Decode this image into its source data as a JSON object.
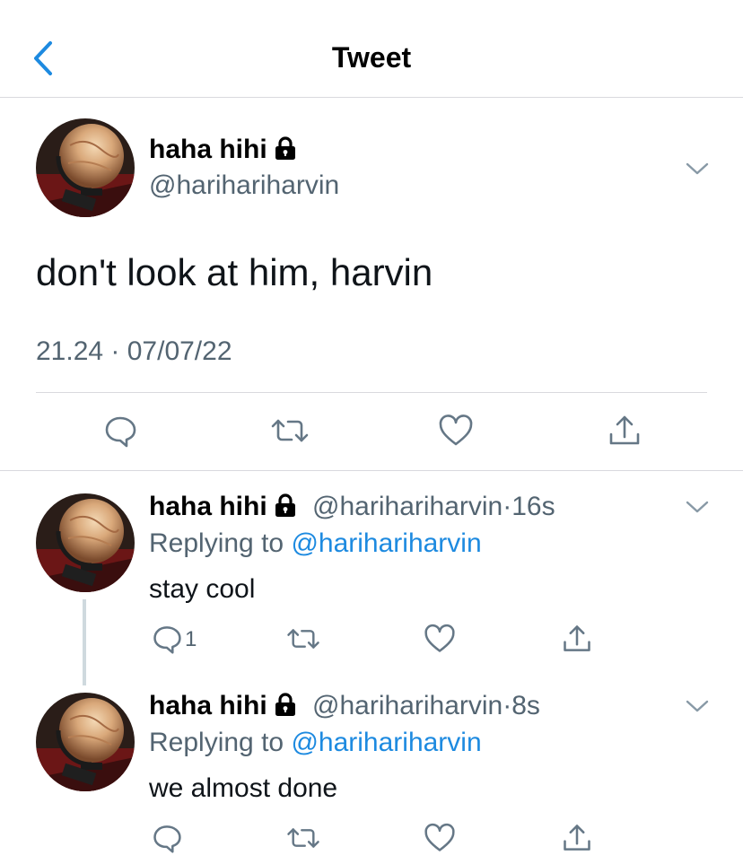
{
  "header": {
    "title": "Tweet"
  },
  "main_tweet": {
    "name": "haha hihi",
    "handle": "@harihariharvin",
    "text": "don't look at him, harvin",
    "timestamp": "21.24 · 07/07/22"
  },
  "replies": [
    {
      "name": "haha hihi",
      "handle": "@harihariharvin",
      "separator": "·",
      "time": "16s",
      "replying_prefix": "Replying to",
      "replying_to": "@harihariharvin",
      "text": "stay cool",
      "reply_count": "1"
    },
    {
      "name": "haha hihi",
      "handle": "@harihariharvin",
      "separator": "·",
      "time": "8s",
      "replying_prefix": "Replying to",
      "replying_to": "@harihariharvin",
      "text": "we almost done"
    }
  ],
  "icons": [
    "back-arrow-icon",
    "lock-icon",
    "chevron-down-icon",
    "reply-icon",
    "retweet-icon",
    "like-icon",
    "share-icon"
  ],
  "colors": {
    "accent": "#1d8ae0",
    "secondary_text": "#536471",
    "divider": "#d9d9de"
  }
}
